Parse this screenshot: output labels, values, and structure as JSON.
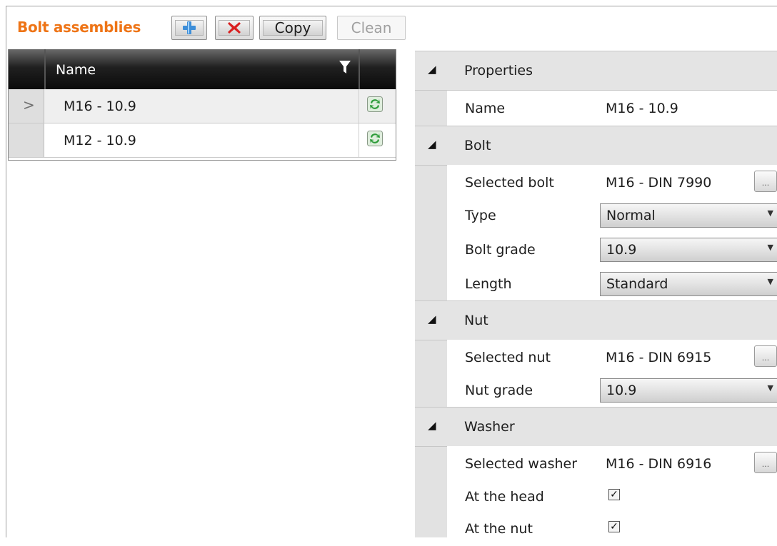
{
  "toolbar": {
    "title": "Bolt assemblies",
    "copy_label": "Copy",
    "clean_label": "Clean"
  },
  "grid": {
    "column_name": "Name",
    "rows": [
      {
        "name": "M16 - 10.9",
        "selected": true
      },
      {
        "name": "M12 - 10.9",
        "selected": false
      }
    ]
  },
  "properties": {
    "category": "Properties",
    "name_label": "Name",
    "name_value": "M16 - 10.9"
  },
  "bolt": {
    "category": "Bolt",
    "selected_label": "Selected bolt",
    "selected_value": "M16 - DIN 7990",
    "type_label": "Type",
    "type_value": "Normal",
    "grade_label": "Bolt grade",
    "grade_value": "10.9",
    "length_label": "Length",
    "length_value": "Standard"
  },
  "nut": {
    "category": "Nut",
    "selected_label": "Selected nut",
    "selected_value": "M16 - DIN 6915",
    "grade_label": "Nut grade",
    "grade_value": "10.9"
  },
  "washer": {
    "category": "Washer",
    "selected_label": "Selected washer",
    "selected_value": "M16 - DIN 6916",
    "head_label": "At the head",
    "head_checked": true,
    "nut_label": "At the nut",
    "nut_checked": true
  },
  "colors": {
    "title": "#ee7416",
    "header_bg": "#0a0a0a",
    "category_bg": "#e4e4e4"
  }
}
